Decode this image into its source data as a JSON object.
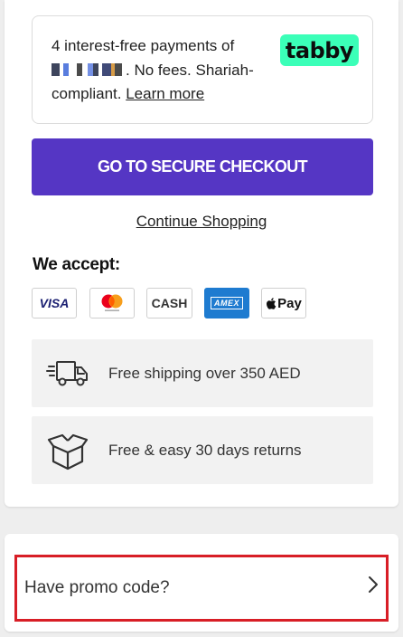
{
  "tabby": {
    "text_line1": "4 interest-free payments of",
    "masked_amount": "",
    "text_rest": ". No fees. Shariah-compliant.",
    "learn_more": "Learn more",
    "logo": "tabby",
    "logo_color": "#3bffb8"
  },
  "checkout": {
    "button_label": "GO TO SECURE CHECKOUT",
    "button_color": "#5536c4",
    "continue_label": "Continue Shopping"
  },
  "payments": {
    "title": "We accept:",
    "methods": [
      {
        "name": "VISA",
        "icon": "visa-icon"
      },
      {
        "name": "",
        "icon": "mastercard-icon"
      },
      {
        "name": "CASH",
        "icon": "cash-icon"
      },
      {
        "name": "AMEX",
        "icon": "amex-icon"
      },
      {
        "name": "Pay",
        "icon": "apple-pay-icon"
      }
    ]
  },
  "features": [
    {
      "icon": "delivery-truck-icon",
      "text": "Free shipping over 350 AED"
    },
    {
      "icon": "open-box-icon",
      "text": "Free & easy 30 days returns"
    }
  ],
  "promo": {
    "label": "Have promo code?",
    "icon": "chevron-right-icon",
    "highlight_color": "#d81e26"
  }
}
